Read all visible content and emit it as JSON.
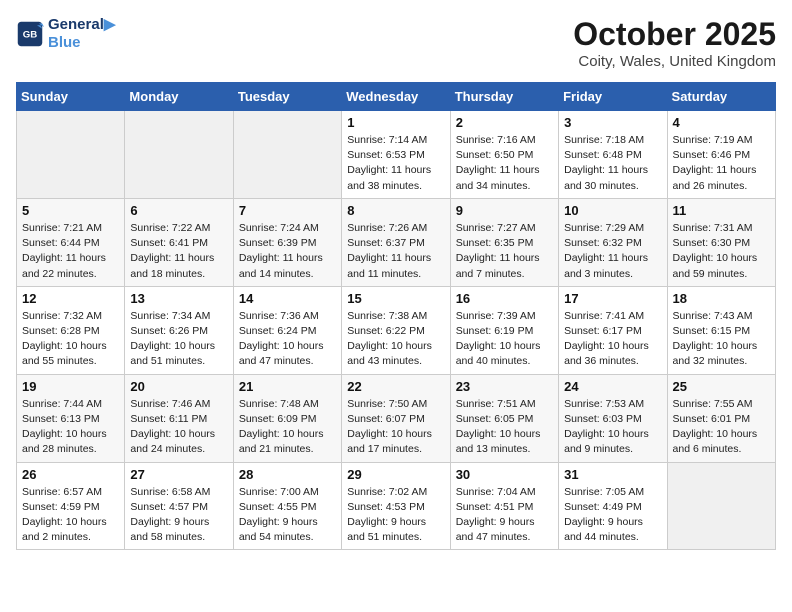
{
  "logo": {
    "line1": "General",
    "line2": "Blue"
  },
  "title": "October 2025",
  "subtitle": "Coity, Wales, United Kingdom",
  "weekdays": [
    "Sunday",
    "Monday",
    "Tuesday",
    "Wednesday",
    "Thursday",
    "Friday",
    "Saturday"
  ],
  "weeks": [
    [
      {
        "day": "",
        "info": ""
      },
      {
        "day": "",
        "info": ""
      },
      {
        "day": "",
        "info": ""
      },
      {
        "day": "1",
        "info": "Sunrise: 7:14 AM\nSunset: 6:53 PM\nDaylight: 11 hours\nand 38 minutes."
      },
      {
        "day": "2",
        "info": "Sunrise: 7:16 AM\nSunset: 6:50 PM\nDaylight: 11 hours\nand 34 minutes."
      },
      {
        "day": "3",
        "info": "Sunrise: 7:18 AM\nSunset: 6:48 PM\nDaylight: 11 hours\nand 30 minutes."
      },
      {
        "day": "4",
        "info": "Sunrise: 7:19 AM\nSunset: 6:46 PM\nDaylight: 11 hours\nand 26 minutes."
      }
    ],
    [
      {
        "day": "5",
        "info": "Sunrise: 7:21 AM\nSunset: 6:44 PM\nDaylight: 11 hours\nand 22 minutes."
      },
      {
        "day": "6",
        "info": "Sunrise: 7:22 AM\nSunset: 6:41 PM\nDaylight: 11 hours\nand 18 minutes."
      },
      {
        "day": "7",
        "info": "Sunrise: 7:24 AM\nSunset: 6:39 PM\nDaylight: 11 hours\nand 14 minutes."
      },
      {
        "day": "8",
        "info": "Sunrise: 7:26 AM\nSunset: 6:37 PM\nDaylight: 11 hours\nand 11 minutes."
      },
      {
        "day": "9",
        "info": "Sunrise: 7:27 AM\nSunset: 6:35 PM\nDaylight: 11 hours\nand 7 minutes."
      },
      {
        "day": "10",
        "info": "Sunrise: 7:29 AM\nSunset: 6:32 PM\nDaylight: 11 hours\nand 3 minutes."
      },
      {
        "day": "11",
        "info": "Sunrise: 7:31 AM\nSunset: 6:30 PM\nDaylight: 10 hours\nand 59 minutes."
      }
    ],
    [
      {
        "day": "12",
        "info": "Sunrise: 7:32 AM\nSunset: 6:28 PM\nDaylight: 10 hours\nand 55 minutes."
      },
      {
        "day": "13",
        "info": "Sunrise: 7:34 AM\nSunset: 6:26 PM\nDaylight: 10 hours\nand 51 minutes."
      },
      {
        "day": "14",
        "info": "Sunrise: 7:36 AM\nSunset: 6:24 PM\nDaylight: 10 hours\nand 47 minutes."
      },
      {
        "day": "15",
        "info": "Sunrise: 7:38 AM\nSunset: 6:22 PM\nDaylight: 10 hours\nand 43 minutes."
      },
      {
        "day": "16",
        "info": "Sunrise: 7:39 AM\nSunset: 6:19 PM\nDaylight: 10 hours\nand 40 minutes."
      },
      {
        "day": "17",
        "info": "Sunrise: 7:41 AM\nSunset: 6:17 PM\nDaylight: 10 hours\nand 36 minutes."
      },
      {
        "day": "18",
        "info": "Sunrise: 7:43 AM\nSunset: 6:15 PM\nDaylight: 10 hours\nand 32 minutes."
      }
    ],
    [
      {
        "day": "19",
        "info": "Sunrise: 7:44 AM\nSunset: 6:13 PM\nDaylight: 10 hours\nand 28 minutes."
      },
      {
        "day": "20",
        "info": "Sunrise: 7:46 AM\nSunset: 6:11 PM\nDaylight: 10 hours\nand 24 minutes."
      },
      {
        "day": "21",
        "info": "Sunrise: 7:48 AM\nSunset: 6:09 PM\nDaylight: 10 hours\nand 21 minutes."
      },
      {
        "day": "22",
        "info": "Sunrise: 7:50 AM\nSunset: 6:07 PM\nDaylight: 10 hours\nand 17 minutes."
      },
      {
        "day": "23",
        "info": "Sunrise: 7:51 AM\nSunset: 6:05 PM\nDaylight: 10 hours\nand 13 minutes."
      },
      {
        "day": "24",
        "info": "Sunrise: 7:53 AM\nSunset: 6:03 PM\nDaylight: 10 hours\nand 9 minutes."
      },
      {
        "day": "25",
        "info": "Sunrise: 7:55 AM\nSunset: 6:01 PM\nDaylight: 10 hours\nand 6 minutes."
      }
    ],
    [
      {
        "day": "26",
        "info": "Sunrise: 6:57 AM\nSunset: 4:59 PM\nDaylight: 10 hours\nand 2 minutes."
      },
      {
        "day": "27",
        "info": "Sunrise: 6:58 AM\nSunset: 4:57 PM\nDaylight: 9 hours\nand 58 minutes."
      },
      {
        "day": "28",
        "info": "Sunrise: 7:00 AM\nSunset: 4:55 PM\nDaylight: 9 hours\nand 54 minutes."
      },
      {
        "day": "29",
        "info": "Sunrise: 7:02 AM\nSunset: 4:53 PM\nDaylight: 9 hours\nand 51 minutes."
      },
      {
        "day": "30",
        "info": "Sunrise: 7:04 AM\nSunset: 4:51 PM\nDaylight: 9 hours\nand 47 minutes."
      },
      {
        "day": "31",
        "info": "Sunrise: 7:05 AM\nSunset: 4:49 PM\nDaylight: 9 hours\nand 44 minutes."
      },
      {
        "day": "",
        "info": ""
      }
    ]
  ]
}
